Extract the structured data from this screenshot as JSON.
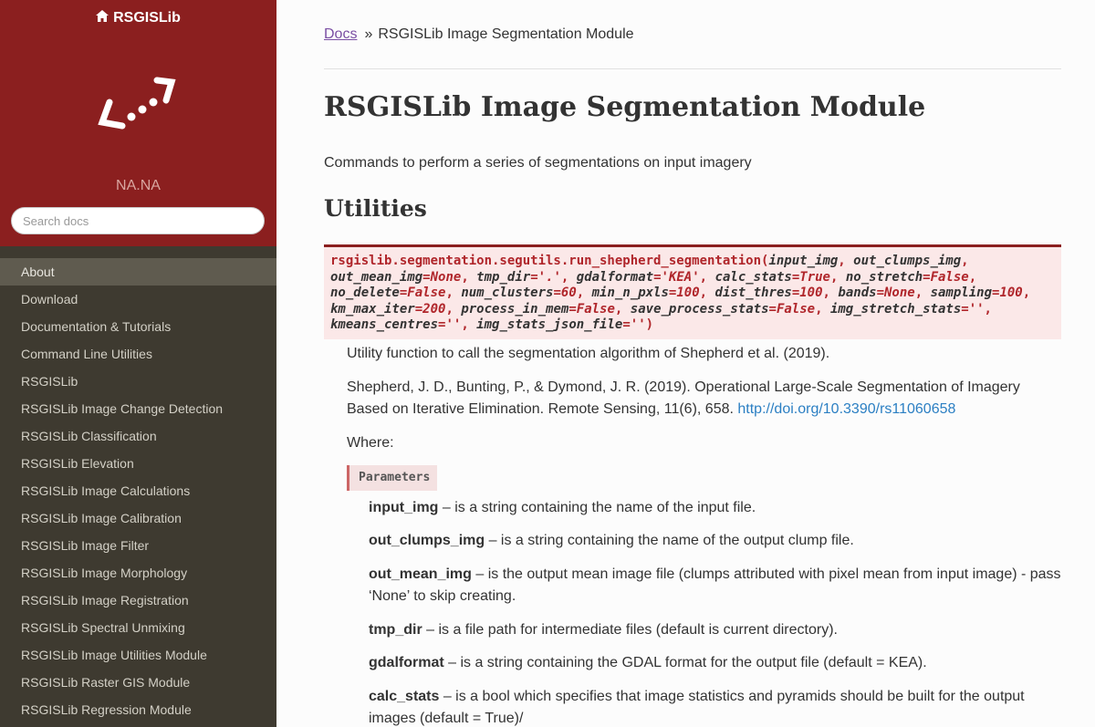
{
  "sidebar": {
    "brand": "RSGISLib",
    "brand_icon": "home-icon",
    "version": "NA.NA",
    "search_placeholder": "Search docs",
    "items": [
      {
        "label": "About",
        "current": true
      },
      {
        "label": "Download"
      },
      {
        "label": "Documentation & Tutorials"
      },
      {
        "label": "Command Line Utilities"
      },
      {
        "label": "RSGISLib"
      },
      {
        "label": "RSGISLib Image Change Detection"
      },
      {
        "label": "RSGISLib Classification"
      },
      {
        "label": "RSGISLib Elevation"
      },
      {
        "label": "RSGISLib Image Calculations"
      },
      {
        "label": "RSGISLib Image Calibration"
      },
      {
        "label": "RSGISLib Image Filter"
      },
      {
        "label": "RSGISLib Image Morphology"
      },
      {
        "label": "RSGISLib Image Registration"
      },
      {
        "label": "RSGISLib Spectral Unmixing"
      },
      {
        "label": "RSGISLib Image Utilities Module"
      },
      {
        "label": "RSGISLib Raster GIS Module"
      },
      {
        "label": "RSGISLib Regression Module"
      }
    ]
  },
  "breadcrumb": {
    "root": "Docs",
    "separator": "»",
    "current": "RSGISLib Image Segmentation Module"
  },
  "page": {
    "title": "RSGISLib Image Segmentation Module",
    "intro": "Commands to perform a series of segmentations on input imagery",
    "section": "Utilities"
  },
  "function": {
    "name": "rsgislib.segmentation.segutils.run_shepherd_segmentation(",
    "params": [
      [
        "input_img",
        null
      ],
      [
        "out_clumps_img",
        null
      ],
      [
        "out_mean_img",
        "None"
      ],
      [
        "tmp_dir",
        "'.'"
      ],
      [
        "gdalformat",
        "'KEA'"
      ],
      [
        "calc_stats",
        "True"
      ],
      [
        "no_stretch",
        "False"
      ],
      [
        "no_delete",
        "False"
      ],
      [
        "num_clusters",
        "60"
      ],
      [
        "min_n_pxls",
        "100"
      ],
      [
        "dist_thres",
        "100"
      ],
      [
        "bands",
        "None"
      ],
      [
        "sampling",
        "100"
      ],
      [
        "km_max_iter",
        "200"
      ],
      [
        "process_in_mem",
        "False"
      ],
      [
        "save_process_stats",
        "False"
      ],
      [
        "img_stretch_stats",
        "''"
      ],
      [
        "kmeans_centres",
        "''"
      ],
      [
        "img_stats_json_file",
        "''"
      ]
    ],
    "description": "Utility function to call the segmentation algorithm of Shepherd et al. (2019).",
    "citation": "Shepherd, J. D., Bunting, P., & Dymond, J. R. (2019). Operational Large-Scale Segmentation of Imagery Based on Iterative Elimination. Remote Sensing, 11(6), 658.",
    "citation_link": "http://doi.org/10.3390/rs11060658",
    "where": "Where:",
    "params_heading": "Parameters"
  },
  "param_docs": [
    {
      "name": "input_img",
      "desc": " – is a string containing the name of the input file."
    },
    {
      "name": "out_clumps_img",
      "desc": " – is a string containing the name of the output clump file."
    },
    {
      "name": "out_mean_img",
      "desc": " – is the output mean image file (clumps attributed with pixel mean from input image) - pass ‘None’ to skip creating."
    },
    {
      "name": "tmp_dir",
      "desc": " – is a file path for intermediate files (default is current directory)."
    },
    {
      "name": "gdalformat",
      "desc": " – is a string containing the GDAL format for the output file (default = KEA)."
    },
    {
      "name": "calc_stats",
      "desc": " – is a bool which specifies that image statistics and pyramids should be built for the output images (default = True)/"
    }
  ],
  "colors": {
    "sidebar_top": "#8b1f1f",
    "sidebar": "#3e3a30",
    "link": "#2b7fc3",
    "sig_bg": "#fbe8e8"
  }
}
